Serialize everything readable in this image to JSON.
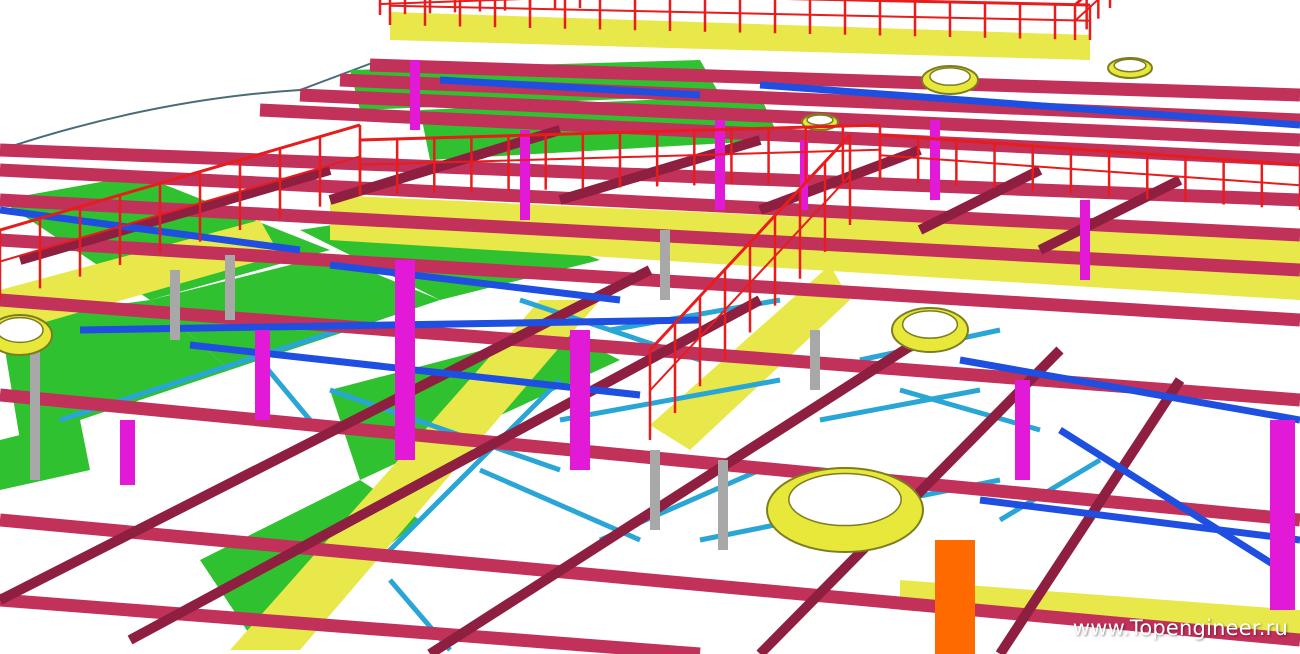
{
  "image": {
    "subject": "3D steel structure model render",
    "watermark_text": "www.Topengineer.ru"
  },
  "palette": {
    "beam": "#c2315a",
    "beam_dark": "#8f1f40",
    "grating": "#2fc12f",
    "platform": "#e8e84a",
    "handrail": "#e81c1c",
    "pipe": "#1f4fe0",
    "bracing": "#2aa6d6",
    "column": "#e21ad8",
    "support": "#a8a8a8",
    "ring": "#e8e83a",
    "accent": "#ff6a00",
    "background": "#ffffff"
  }
}
